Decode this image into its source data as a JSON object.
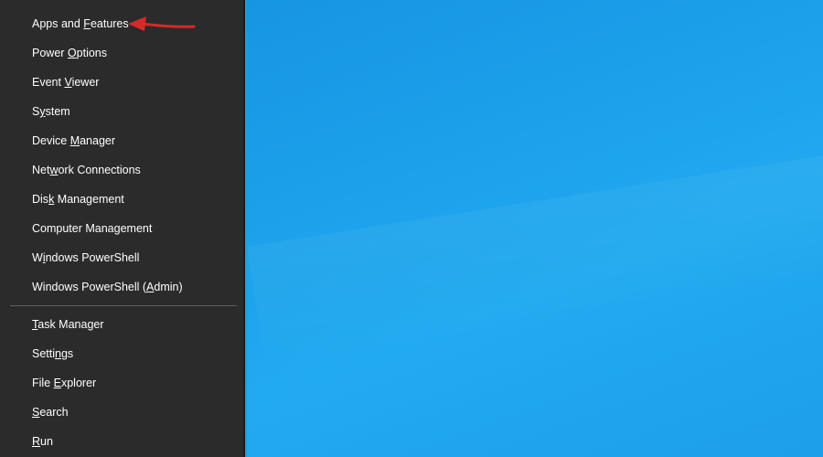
{
  "menu": {
    "items": [
      {
        "pre": "Apps and ",
        "ul": "F",
        "post": "eatures"
      },
      {
        "pre": "Power ",
        "ul": "O",
        "post": "ptions"
      },
      {
        "pre": "Event ",
        "ul": "V",
        "post": "iewer"
      },
      {
        "pre": "S",
        "ul": "y",
        "post": "stem"
      },
      {
        "pre": "Device ",
        "ul": "M",
        "post": "anager"
      },
      {
        "pre": "Net",
        "ul": "w",
        "post": "ork Connections"
      },
      {
        "pre": "Dis",
        "ul": "k",
        "post": " Management"
      },
      {
        "pre": "Computer Mana",
        "ul": "g",
        "post": "ement"
      },
      {
        "pre": "W",
        "ul": "i",
        "post": "ndows PowerShell"
      },
      {
        "pre": "Windows PowerShell (",
        "ul": "A",
        "post": "dmin)"
      }
    ],
    "items2": [
      {
        "pre": "",
        "ul": "T",
        "post": "ask Manager"
      },
      {
        "pre": "Setti",
        "ul": "n",
        "post": "gs"
      },
      {
        "pre": "File ",
        "ul": "E",
        "post": "xplorer"
      },
      {
        "pre": "",
        "ul": "S",
        "post": "earch"
      },
      {
        "pre": "",
        "ul": "R",
        "post": "un"
      }
    ]
  },
  "annotation": {
    "arrow_color": "#d42a2a",
    "arrow_icon": "red-arrow-pointing-left"
  },
  "colors": {
    "menu_bg": "#2b2b2b",
    "desktop_blue": "#1ea4ec"
  }
}
